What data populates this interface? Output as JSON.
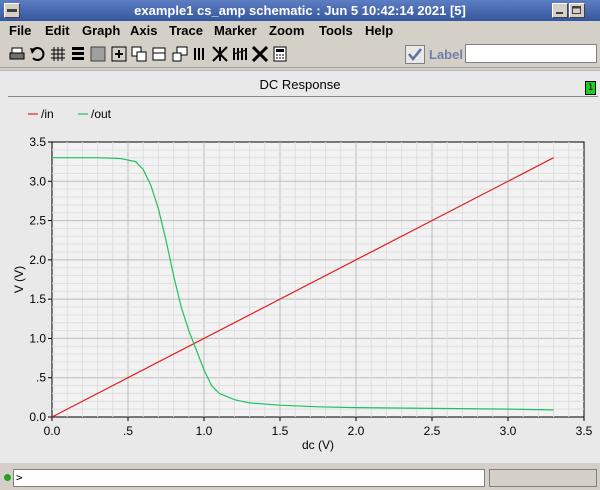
{
  "window": {
    "title": "example1 cs_amp schematic :  Jun  5 10:42:14 2021 [5]"
  },
  "menu": [
    "File",
    "Edit",
    "Graph",
    "Axis",
    "Trace",
    "Marker",
    "Zoom",
    "Tools",
    "Help"
  ],
  "toolbar": {
    "icons": [
      "print-icon",
      "undo-icon",
      "grid-icon",
      "strip-icon",
      "frame-icon",
      "zoom-fit-icon",
      "window-icon",
      "new-window-icon",
      "list-icon",
      "marker-icon",
      "delete-marker-icon",
      "calculator-icon"
    ],
    "label_text": "Label",
    "label_value": ""
  },
  "subwindow_number": "1",
  "status": {
    "prompt": ">"
  },
  "colors": {
    "in": "#e02020",
    "out": "#20c060",
    "grid": "#c8c8c8",
    "plot_bg": "#f2f2f2"
  },
  "chart_data": {
    "type": "line",
    "title": "DC Response",
    "xlabel": "dc (V)",
    "ylabel": "V (V)",
    "xlim": [
      0.0,
      3.5
    ],
    "ylim": [
      0.0,
      3.5
    ],
    "x_ticks": [
      "0.0",
      ".5",
      "1.0",
      "1.5",
      "2.0",
      "2.5",
      "3.0",
      "3.5"
    ],
    "y_ticks": [
      "0.0",
      ".5",
      "1.0",
      "1.5",
      "2.0",
      "2.5",
      "3.0",
      "3.5"
    ],
    "grid": true,
    "legend_position": "top-left",
    "series": [
      {
        "name": "/in",
        "x": [
          0.0,
          3.3
        ],
        "y": [
          0.0,
          3.3
        ]
      },
      {
        "name": "/out",
        "x": [
          0.0,
          0.3,
          0.45,
          0.55,
          0.6,
          0.65,
          0.7,
          0.75,
          0.8,
          0.85,
          0.9,
          0.95,
          1.0,
          1.05,
          1.1,
          1.2,
          1.3,
          1.5,
          1.75,
          2.0,
          2.5,
          3.0,
          3.3
        ],
        "y": [
          3.3,
          3.3,
          3.29,
          3.25,
          3.15,
          2.95,
          2.65,
          2.25,
          1.8,
          1.4,
          1.1,
          0.85,
          0.6,
          0.4,
          0.3,
          0.22,
          0.18,
          0.15,
          0.13,
          0.12,
          0.11,
          0.1,
          0.09
        ]
      }
    ]
  }
}
